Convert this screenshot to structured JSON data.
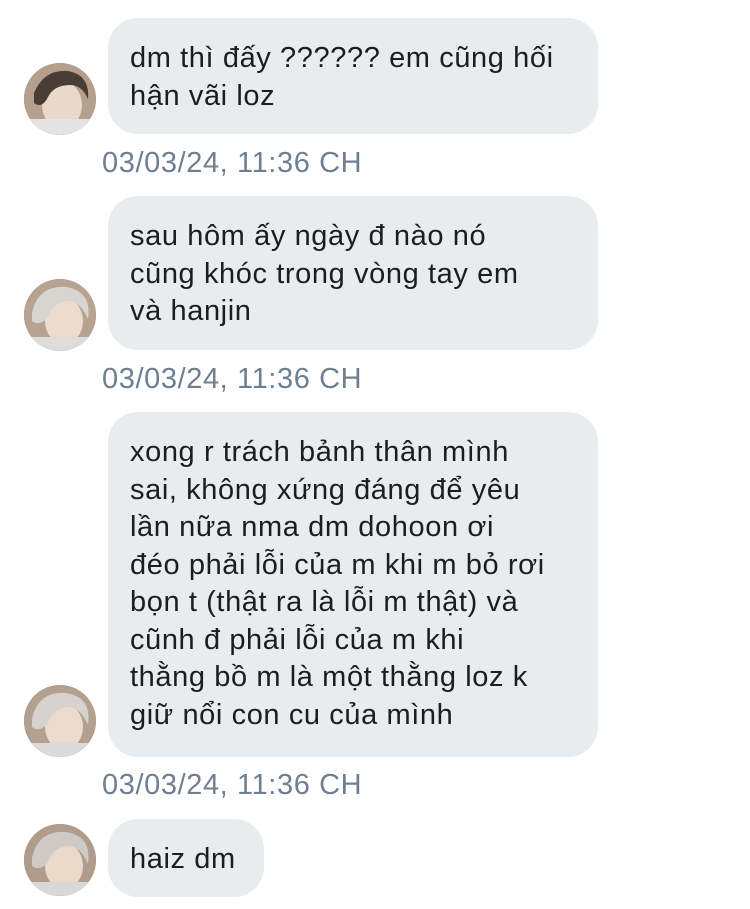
{
  "messages": [
    {
      "text": "dm thì đấy ?????? em cũng hối\nhận vãi loz",
      "timestamp": "03/03/24, 11:36 CH"
    },
    {
      "text": "sau hôm ấy ngày đ nào nó\ncũng khóc trong vòng tay em\nvà hanjin",
      "timestamp": "03/03/24, 11:36 CH"
    },
    {
      "text": "xong r trách bảnh thân mình\nsai, không xứng đáng để yêu\nlần nữa nma dm dohoon ơi\nđéo phải lỗi của m khi m bỏ rơi\nbọn t (thật ra là lỗi m thật) và\ncũnh đ phải lỗi của m khi\nthằng bồ m là một thằng loz k\ngiữ nổi con cu của mình",
      "timestamp": "03/03/24, 11:36 CH"
    },
    {
      "text": "haiz dm",
      "timestamp": ""
    }
  ],
  "avatar_icon": "user-avatar-photo"
}
